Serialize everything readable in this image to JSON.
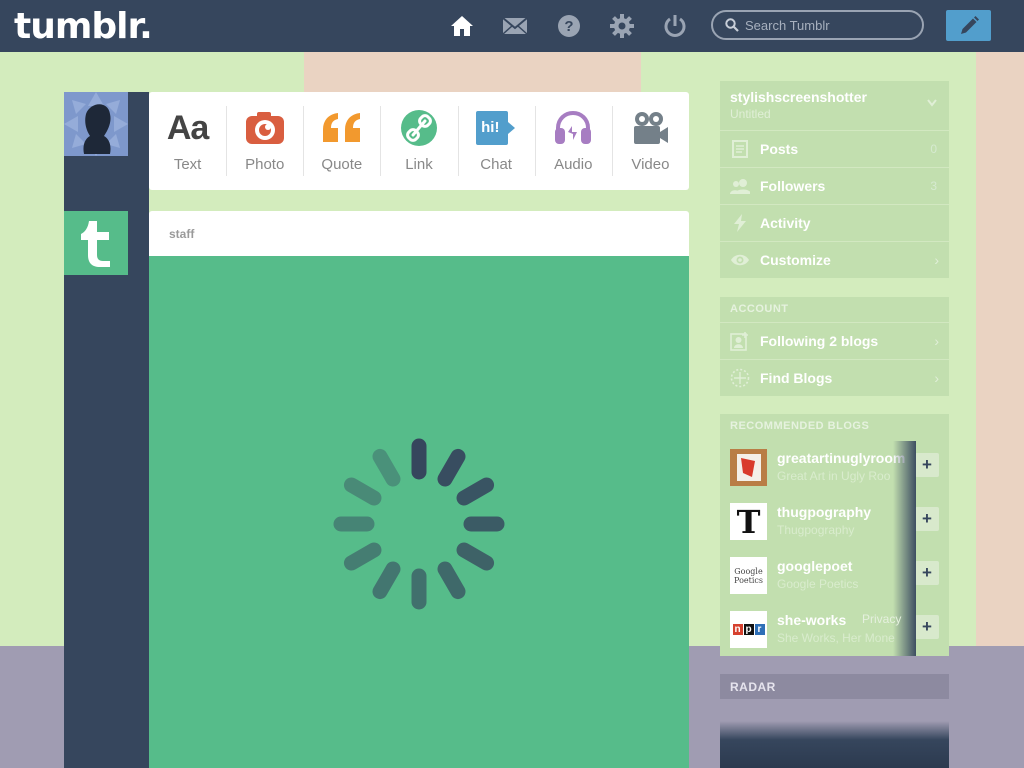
{
  "header": {
    "logo": "tumblr.",
    "search_placeholder": "Search Tumblr",
    "icons": [
      "home-icon",
      "mail-icon",
      "help-icon",
      "gear-icon",
      "power-icon"
    ],
    "compose_icon": "pencil-icon"
  },
  "post_types": [
    {
      "label": "Text",
      "icon": "text-icon",
      "color": "#444444"
    },
    {
      "label": "Photo",
      "icon": "camera-icon",
      "color": "#d95e40"
    },
    {
      "label": "Quote",
      "icon": "quote-icon",
      "color": "#f2992e"
    },
    {
      "label": "Link",
      "icon": "link-icon",
      "color": "#56bc8a"
    },
    {
      "label": "Chat",
      "icon": "chat-icon",
      "color": "#529ecc"
    },
    {
      "label": "Audio",
      "icon": "headphones-icon",
      "color": "#a77dc2"
    },
    {
      "label": "Video",
      "icon": "video-camera-icon",
      "color": "#748089"
    }
  ],
  "post": {
    "author": "staff",
    "chat_bubble_text": "hi!"
  },
  "blog": {
    "name": "stylishscreenshotter",
    "title": "Untitled",
    "menu": [
      {
        "label": "Posts",
        "count": "0",
        "icon": "posts-icon"
      },
      {
        "label": "Followers",
        "count": "3",
        "icon": "followers-icon"
      },
      {
        "label": "Activity",
        "count": "",
        "icon": "bolt-icon"
      },
      {
        "label": "Customize",
        "count": "",
        "icon": "eye-icon"
      }
    ]
  },
  "account": {
    "heading": "ACCOUNT",
    "items": [
      {
        "label": "Following 2 blogs",
        "icon": "following-icon"
      },
      {
        "label": "Find Blogs",
        "icon": "compass-icon"
      }
    ]
  },
  "recommended": {
    "heading": "RECOMMENDED BLOGS",
    "items": [
      {
        "name": "greatartinuglyroom",
        "subtitle": "Great Art in Ugly Roo"
      },
      {
        "name": "thugpography",
        "subtitle": "Thugpography"
      },
      {
        "name": "googlepoet",
        "subtitle": "Google Poetics"
      },
      {
        "name": "she-works",
        "subtitle": "She Works, Her Mone"
      }
    ],
    "thumb_texts": [
      "T",
      "Google Poetics",
      "n",
      "p",
      "r"
    ]
  },
  "footer": {
    "privacy": "Privacy"
  },
  "radar": {
    "heading": "RADAR"
  },
  "colors": {
    "nav": "#36465d",
    "staff_green": "#56bc8a",
    "accent_blue": "#529ecc",
    "sidebar_bg": "#c2dfaf"
  }
}
